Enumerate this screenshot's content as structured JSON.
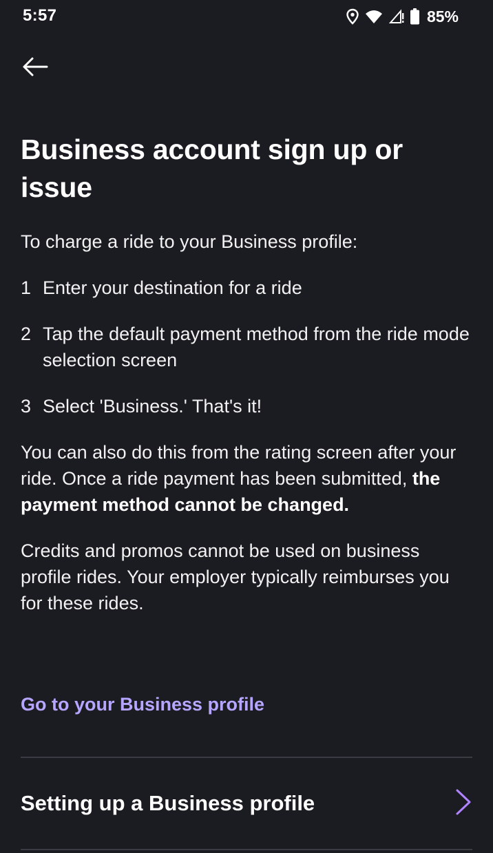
{
  "status_bar": {
    "time": "5:57",
    "battery_percent": "85%",
    "icons": [
      "location-pin-icon",
      "wifi-icon",
      "cellular-signal-icon",
      "battery-icon"
    ]
  },
  "nav": {
    "back_icon": "arrow-left-icon"
  },
  "article": {
    "title": "Business account sign up or issue",
    "intro": "To charge a ride to your Business profile:",
    "steps": [
      {
        "num": "1",
        "text": "Enter your destination for a ride"
      },
      {
        "num": "2",
        "text": "Tap the default payment method from the ride mode selection screen"
      },
      {
        "num": "3",
        "text": "Select 'Business.' That's it!"
      }
    ],
    "para2_normal": "You can also do this from the rating screen after your ride. Once a ride payment has been submitted, ",
    "para2_bold": "the payment method cannot be changed.",
    "para3": "Credits and promos cannot be used on business profile rides. Your employer typically reimburses you for these rides."
  },
  "link": {
    "label": "Go to your Business profile"
  },
  "related": {
    "items": [
      {
        "label": "Setting up a Business profile",
        "icon": "chevron-right-icon"
      }
    ]
  },
  "colors": {
    "background": "#1b1b22",
    "accent": "#b7a6ff",
    "chevron": "#b083ff",
    "divider": "#3b3b44"
  }
}
